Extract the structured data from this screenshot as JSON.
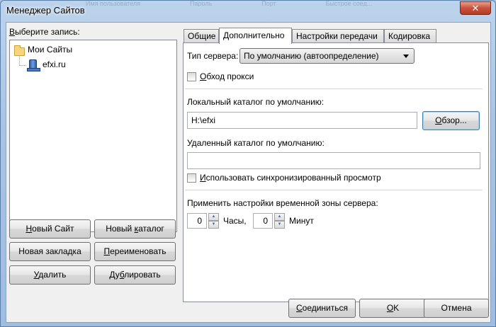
{
  "window": {
    "title": "Менеджер Сайтов",
    "close_glyph": "✕",
    "background_labels": [
      "Имя пользователя",
      "Пароль",
      "Порт",
      "Быстрое соед..."
    ]
  },
  "left": {
    "select_label_prefix": "В",
    "select_label_rest": "ыберите запись:",
    "tree": {
      "root_label": "Мои Сайты",
      "child_label": "efxi.ru"
    },
    "buttons": {
      "new_site": {
        "u": "Н",
        "rest": "овый Сайт"
      },
      "new_folder": {
        "pre": "Новый ",
        "u": "к",
        "rest": "аталог"
      },
      "new_bookmark": {
        "pre": "Новая закладка",
        "u": "",
        "rest": ""
      },
      "rename": {
        "u": "П",
        "rest": "ереименовать"
      },
      "delete": {
        "u": "У",
        "rest": "далить"
      },
      "duplicate": {
        "pre": "Ду",
        "u": "б",
        "rest": "лировать"
      }
    }
  },
  "tabs": [
    {
      "label": "Общие",
      "active": false
    },
    {
      "label": "Дополнительно",
      "active": true
    },
    {
      "label": "Настройки передачи",
      "active": false
    },
    {
      "label": "Кодировка",
      "active": false
    }
  ],
  "advanced": {
    "server_type_label": "Тип сервера:",
    "server_type_value": "По умолчанию (автоопределение)",
    "bypass_proxy": {
      "u": "О",
      "rest": "бход прокси",
      "checked": false
    },
    "local_dir_label": "Локальный каталог по умолчанию:",
    "local_dir_value": "H:\\efxi",
    "browse_button": {
      "u": "О",
      "rest": "бзор..."
    },
    "remote_dir_label": "Удаленный каталог по умолчанию:",
    "remote_dir_value": "",
    "sync_browsing": {
      "u": "И",
      "rest": "спользовать синхронизированный просмотр",
      "checked": false
    },
    "timezone_label": "Применить настройки временной зоны сервера:",
    "hours_value": "0",
    "hours_label": "Часы,",
    "minutes_value": "0",
    "minutes_label": "Минут"
  },
  "footer": {
    "connect": {
      "u": "С",
      "rest": "оединиться"
    },
    "ok": {
      "u": "О",
      "rest": "K"
    },
    "cancel": "Отмена"
  },
  "colors": {
    "accent_focus": "#3c7fb1",
    "close_red": "#c9503a",
    "title_glass": "#a8c3e3"
  },
  "icons": {
    "root": "folder-icon",
    "child": "server-icon"
  }
}
